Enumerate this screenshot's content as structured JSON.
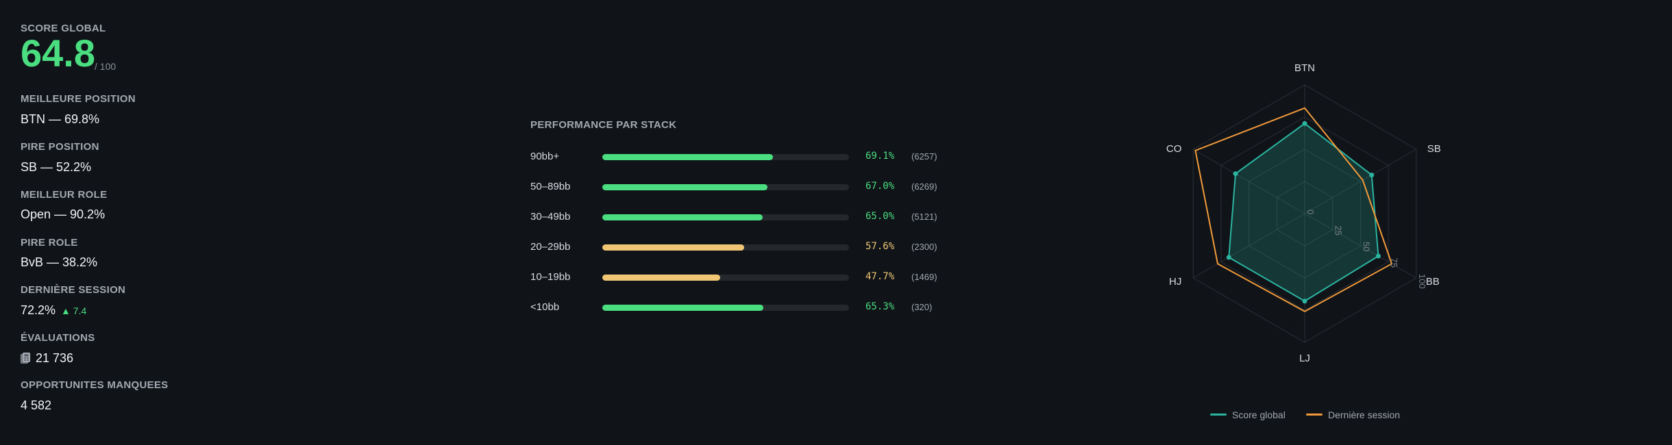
{
  "stats": {
    "score_label": "SCORE GLOBAL",
    "score_value": "64.8",
    "score_max": "/ 100",
    "items": [
      {
        "label": "MEILLEURE POSITION",
        "value": "BTN — 69.8%"
      },
      {
        "label": "PIRE POSITION",
        "value": "SB — 52.2%"
      },
      {
        "label": "MEILLEUR ROLE",
        "value": "Open — 90.2%"
      },
      {
        "label": "PIRE ROLE",
        "value": "BvB — 38.2%"
      },
      {
        "label": "DERNIÈRE SESSION",
        "value": "72.2%",
        "delta": "▲ 7.4"
      },
      {
        "label": "ÉVALUATIONS",
        "value": "21 736",
        "icon": "calculator-icon"
      },
      {
        "label": "OPPORTUNITES MANQUEES",
        "value": "4 582"
      }
    ]
  },
  "stack_performance": {
    "title": "PERFORMANCE PAR STACK",
    "rows": [
      {
        "label": "90bb+",
        "pct": "69.1%",
        "value": 69.1,
        "count": "(6257)",
        "color": "#4ade80"
      },
      {
        "label": "50–89bb",
        "pct": "67.0%",
        "value": 67.0,
        "count": "(6269)",
        "color": "#4ade80"
      },
      {
        "label": "30–49bb",
        "pct": "65.0%",
        "value": 65.0,
        "count": "(5121)",
        "color": "#4ade80"
      },
      {
        "label": "20–29bb",
        "pct": "57.6%",
        "value": 57.6,
        "count": "(2300)",
        "color": "#f0c674"
      },
      {
        "label": "10–19bb",
        "pct": "47.7%",
        "value": 47.7,
        "count": "(1469)",
        "color": "#f0c674"
      },
      {
        "label": "<10bb",
        "pct": "65.3%",
        "value": 65.3,
        "count": "(320)",
        "color": "#4ade80"
      }
    ]
  },
  "chart_data": {
    "type": "radar",
    "axes": [
      "BTN",
      "SB",
      "BB",
      "LJ",
      "HJ",
      "CO"
    ],
    "scale_ticks": [
      "0",
      "25",
      "50",
      "75",
      "100"
    ],
    "range": [
      0,
      100
    ],
    "series": [
      {
        "name": "Score global",
        "values": [
          70,
          60,
          66,
          68,
          68,
          62
        ],
        "color": "#2bb5a0"
      },
      {
        "name": "Dernière session",
        "values": [
          82,
          52,
          78,
          76,
          78,
          98
        ],
        "color": "#f29a3a"
      }
    ],
    "legend_position": "bottom"
  }
}
